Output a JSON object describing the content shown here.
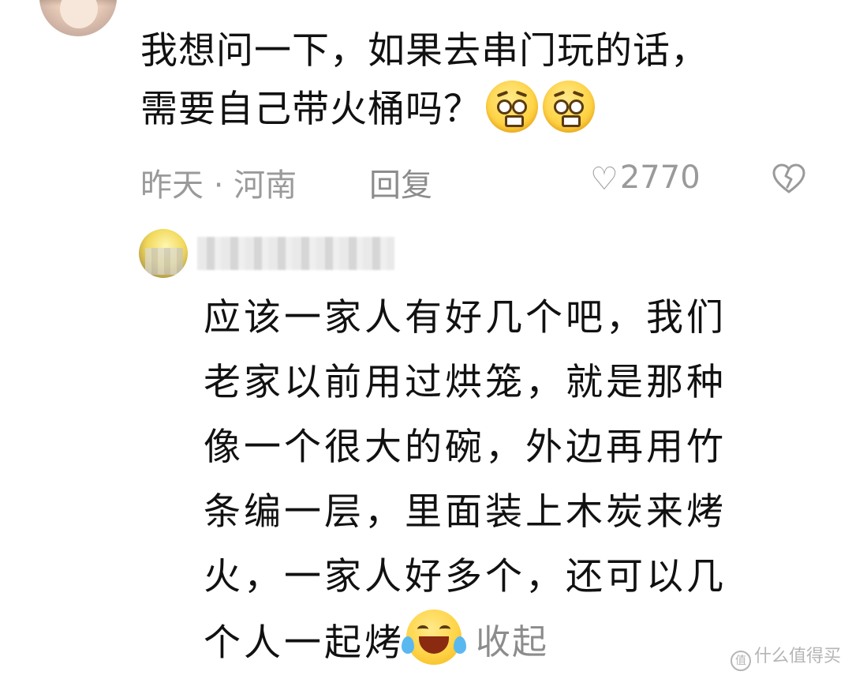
{
  "comment": {
    "text_line1": "我想问一下，如果去串门玩的话，",
    "text_line2": "需要自己带火桶吗？",
    "emojis": [
      "worried-face-icon",
      "worried-face-icon"
    ],
    "time_location": "昨天 · 河南",
    "reply_label": "回复",
    "like_count": "2770",
    "icons": {
      "like": "heart-outline-icon",
      "dislike": "broken-heart-icon"
    }
  },
  "reply": {
    "lines": [
      "应该一家人有好几个吧，我们",
      "老家以前用过烘笼，就是那种",
      "像一个很大的碗，外边再用竹",
      "条编一层，里面装上木炭来烤",
      "火，一家人好多个，还可以几",
      "个人一起烤"
    ],
    "emoji": "laughing-crying-icon",
    "collapse_label": "收起"
  },
  "watermark": {
    "text": "什么值得买",
    "icon_glyph": "值"
  },
  "colors": {
    "text": "#111111",
    "meta": "#9a9a9a",
    "background": "#ffffff"
  }
}
